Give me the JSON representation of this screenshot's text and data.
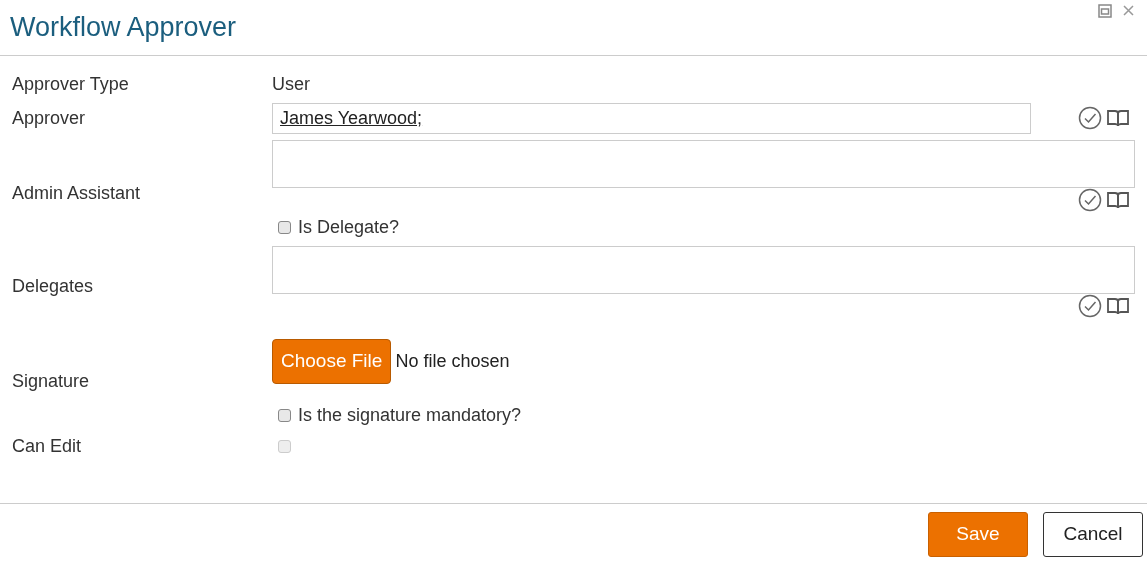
{
  "window": {
    "title": "Workflow Approver"
  },
  "approver_type": {
    "label": "Approver Type",
    "value": "User"
  },
  "approver": {
    "label": "Approver",
    "value": "James Yearwood;"
  },
  "admin_assistant": {
    "label": "Admin Assistant"
  },
  "is_delegate": {
    "label": "Is Delegate?",
    "checked": false
  },
  "delegates": {
    "label": "Delegates"
  },
  "signature": {
    "label": "Signature",
    "button": "Choose File",
    "status": "No file chosen"
  },
  "signature_mandatory": {
    "label": "Is the signature mandatory?",
    "checked": false
  },
  "can_edit": {
    "label": "Can Edit",
    "checked": false,
    "disabled": true
  },
  "buttons": [
    {
      "label": "Save",
      "kind": "primary"
    },
    {
      "label": "Cancel",
      "kind": "secondary"
    }
  ]
}
